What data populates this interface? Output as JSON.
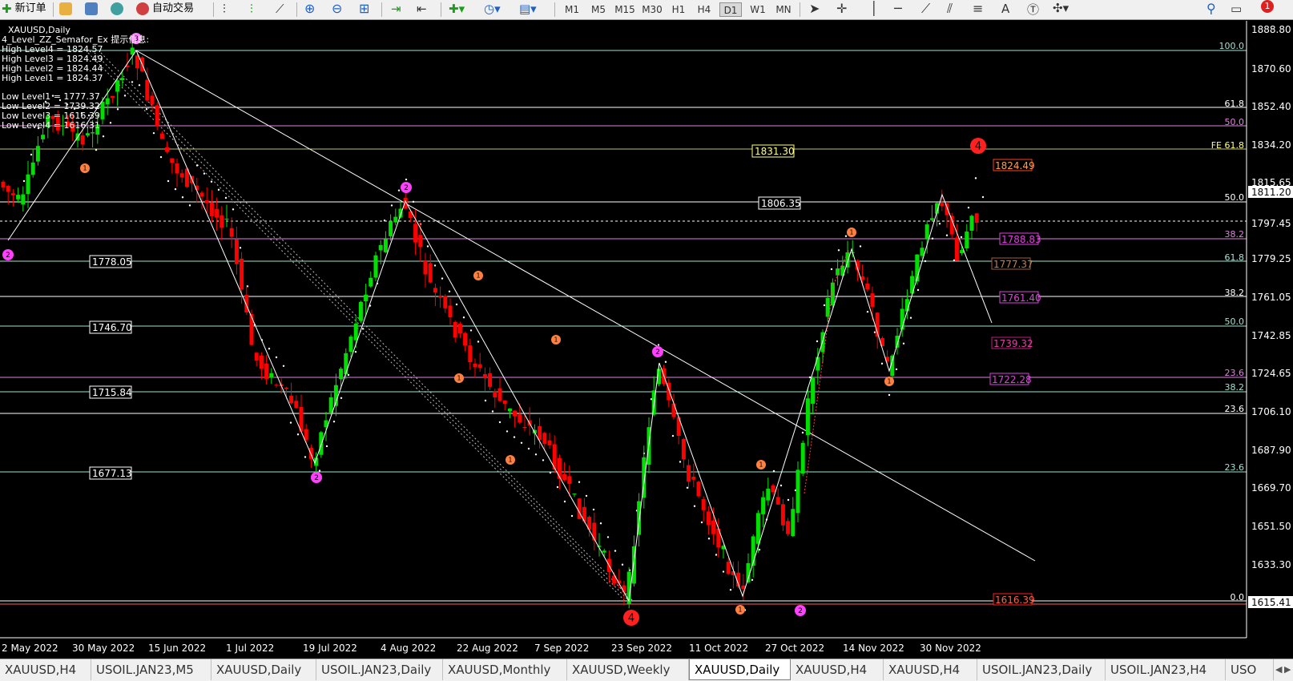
{
  "toolbar": {
    "new_order": "新订单",
    "auto_trading": "自动交易",
    "timeframes": [
      "M1",
      "M5",
      "M15",
      "M30",
      "H1",
      "H4",
      "D1",
      "W1",
      "MN"
    ],
    "active_timeframe": "D1",
    "text_tool": "A",
    "notification_count": "1"
  },
  "chart_info": {
    "symbol": "XAUUSD,Daily",
    "indicator": "4_Level_ZZ_Semafor_Ex 提示信息:",
    "levels": [
      "High Level4 = 1824.57",
      "High Level3 = 1824.49",
      "High Level2 = 1824.44",
      "High Level1 = 1824.37",
      "Low Level1 = 1777.37",
      "Low Level2 = 1739.32",
      "Low Level3 = 1616.39",
      "Low Level4 = 1616.31"
    ]
  },
  "colors": {
    "bull": "#00e000",
    "bear": "#ff0000",
    "cyan_line": "#a0e0d0",
    "magenta_line": "#e080e0",
    "label_orange": "#ff8040",
    "label_magenta": "#ff40ff"
  },
  "price_axis": {
    "ticks": [
      "1888.80",
      "1870.60",
      "1852.40",
      "1834.20",
      "1815.65",
      "1797.45",
      "1779.25",
      "1761.05",
      "1742.85",
      "1724.65",
      "1706.10",
      "1687.90",
      "1669.70",
      "1651.50",
      "1633.30",
      "1615.41"
    ],
    "current_price": "1811.20",
    "bid_line_price": "1796.75"
  },
  "date_axis": [
    "2 May 2022",
    "30 May 2022",
    "15 Jun 2022",
    "1 Jul 2022",
    "19 Jul 2022",
    "4 Aug 2022",
    "22 Aug 2022",
    "7 Sep 2022",
    "23 Sep 2022",
    "11 Oct 2022",
    "27 Oct 2022",
    "14 Nov 2022",
    "30 Nov 2022"
  ],
  "fib_labels": [
    "100.0",
    "61.8",
    "50.0",
    "FE 61.8",
    "50.0",
    "38.2",
    "61.8",
    "38.2",
    "50.0",
    "23.6",
    "38.2",
    "23.6",
    "23.6",
    "0.0"
  ],
  "boxed_labels": [
    "1831.30",
    "1806.35",
    "1778.05",
    "1746.70",
    "1715.84",
    "1677.13"
  ],
  "right_labels": [
    "1824.49",
    "1788.83",
    "1777.37",
    "1761.40",
    "1739.32",
    "1722.28",
    "1616.39"
  ],
  "tabs": [
    "XAUUSD,H4",
    "USOIL.JAN23,M5",
    "XAUUSD,Daily",
    "USOIL.JAN23,Daily",
    "XAUUSD,Monthly",
    "XAUUSD,Weekly",
    "XAUUSD,Daily",
    "XAUUSD,H4",
    "XAUUSD,H4",
    "USOIL.JAN23,Daily",
    "USOIL.JAN23,H4",
    "USO"
  ],
  "active_tab": 6
}
